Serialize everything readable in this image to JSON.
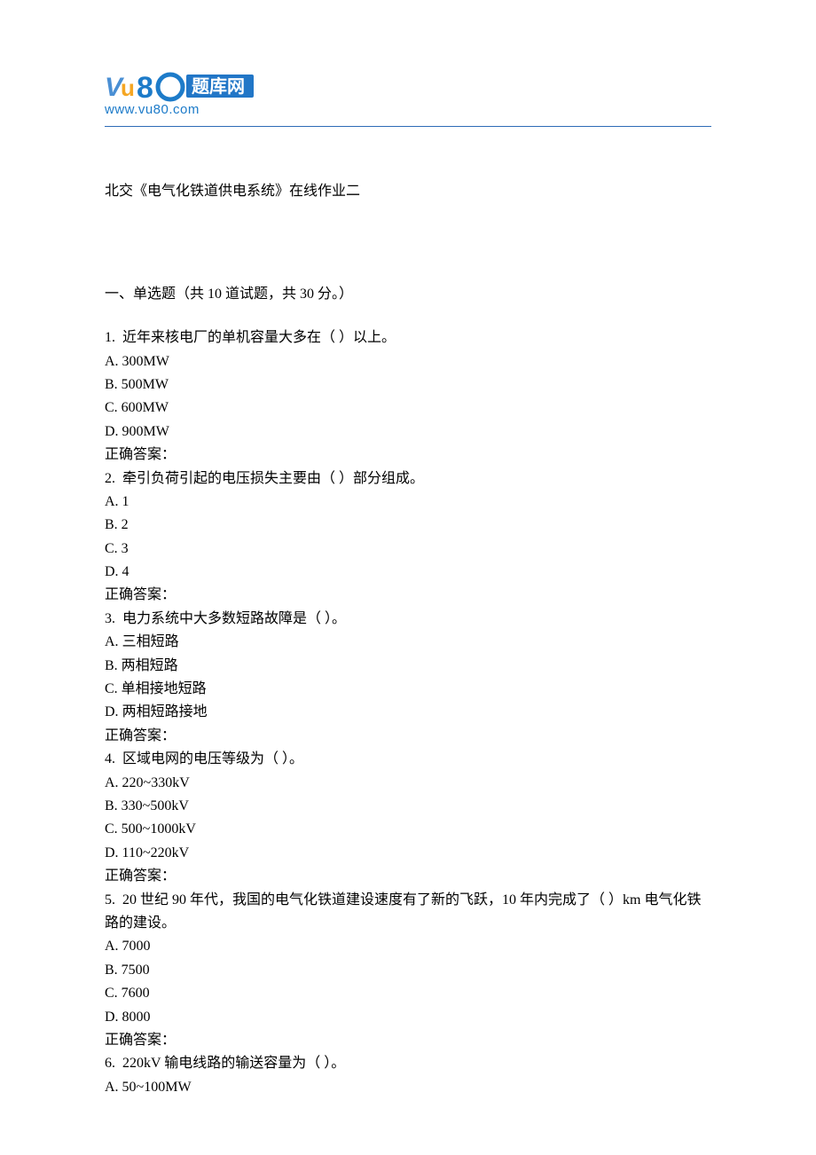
{
  "logo": {
    "main_text": "80",
    "subtitle": "题库网",
    "url": "www.vu80.com"
  },
  "doc_title": "北交《电气化铁道供电系统》在线作业二",
  "section_title": "一、单选题（共 10 道试题，共 30 分。）",
  "questions": [
    {
      "num": "1.",
      "text": "近年来核电厂的单机容量大多在（  ）以上。",
      "options": [
        "A. 300MW",
        "B. 500MW",
        "C. 600MW",
        "D. 900MW"
      ],
      "answer_label": "正确答案："
    },
    {
      "num": "2.",
      "text": "牵引负荷引起的电压损失主要由（  ）部分组成。",
      "options": [
        "A. 1",
        "B. 2",
        "C. 3",
        "D. 4"
      ],
      "answer_label": "正确答案："
    },
    {
      "num": "3.",
      "text": "电力系统中大多数短路故障是（  ）。",
      "options": [
        "A. 三相短路",
        "B. 两相短路",
        "C. 单相接地短路",
        "D. 两相短路接地"
      ],
      "answer_label": "正确答案："
    },
    {
      "num": "4.",
      "text": "区域电网的电压等级为（  ）。",
      "options": [
        "A. 220~330kV",
        "B. 330~500kV",
        "C. 500~1000kV",
        "D. 110~220kV"
      ],
      "answer_label": "正确答案："
    },
    {
      "num": "5.",
      "text": "20 世纪 90 年代，我国的电气化铁道建设速度有了新的飞跃，10 年内完成了（  ）km 电气化铁路的建设。",
      "options": [
        "A. 7000",
        "B. 7500",
        "C. 7600",
        "D. 8000"
      ],
      "answer_label": "正确答案："
    },
    {
      "num": "6.",
      "text": "220kV 输电线路的输送容量为（  ）。",
      "options": [
        "A. 50~100MW"
      ],
      "answer_label": ""
    }
  ]
}
